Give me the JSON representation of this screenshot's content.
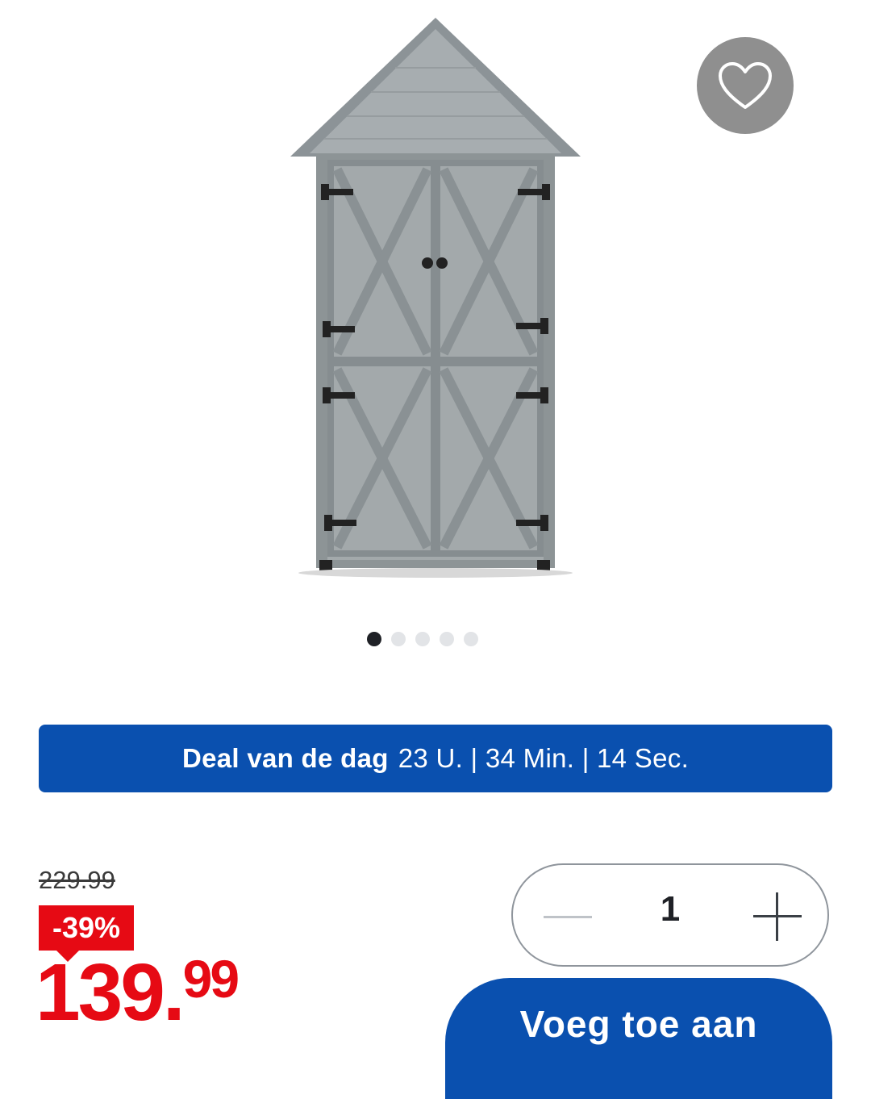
{
  "gallery": {
    "image_alt": "Garden storage cabinet",
    "favorite_icon": "heart-outline-icon",
    "slide_count": 5,
    "active_slide": 1
  },
  "deal": {
    "label": "Deal van de dag",
    "countdown": "23 U. | 34 Min. | 14 Sec."
  },
  "pricing": {
    "old_price": "229.99",
    "discount": "-39%",
    "price_integer": "139.",
    "price_decimal": "99"
  },
  "quantity": {
    "value": "1",
    "minus_icon": "minus-icon",
    "plus_icon": "plus-icon"
  },
  "cart": {
    "add_label": "Voeg toe aan"
  },
  "colors": {
    "brand_blue": "#0a50af",
    "sale_red": "#e60a14"
  }
}
